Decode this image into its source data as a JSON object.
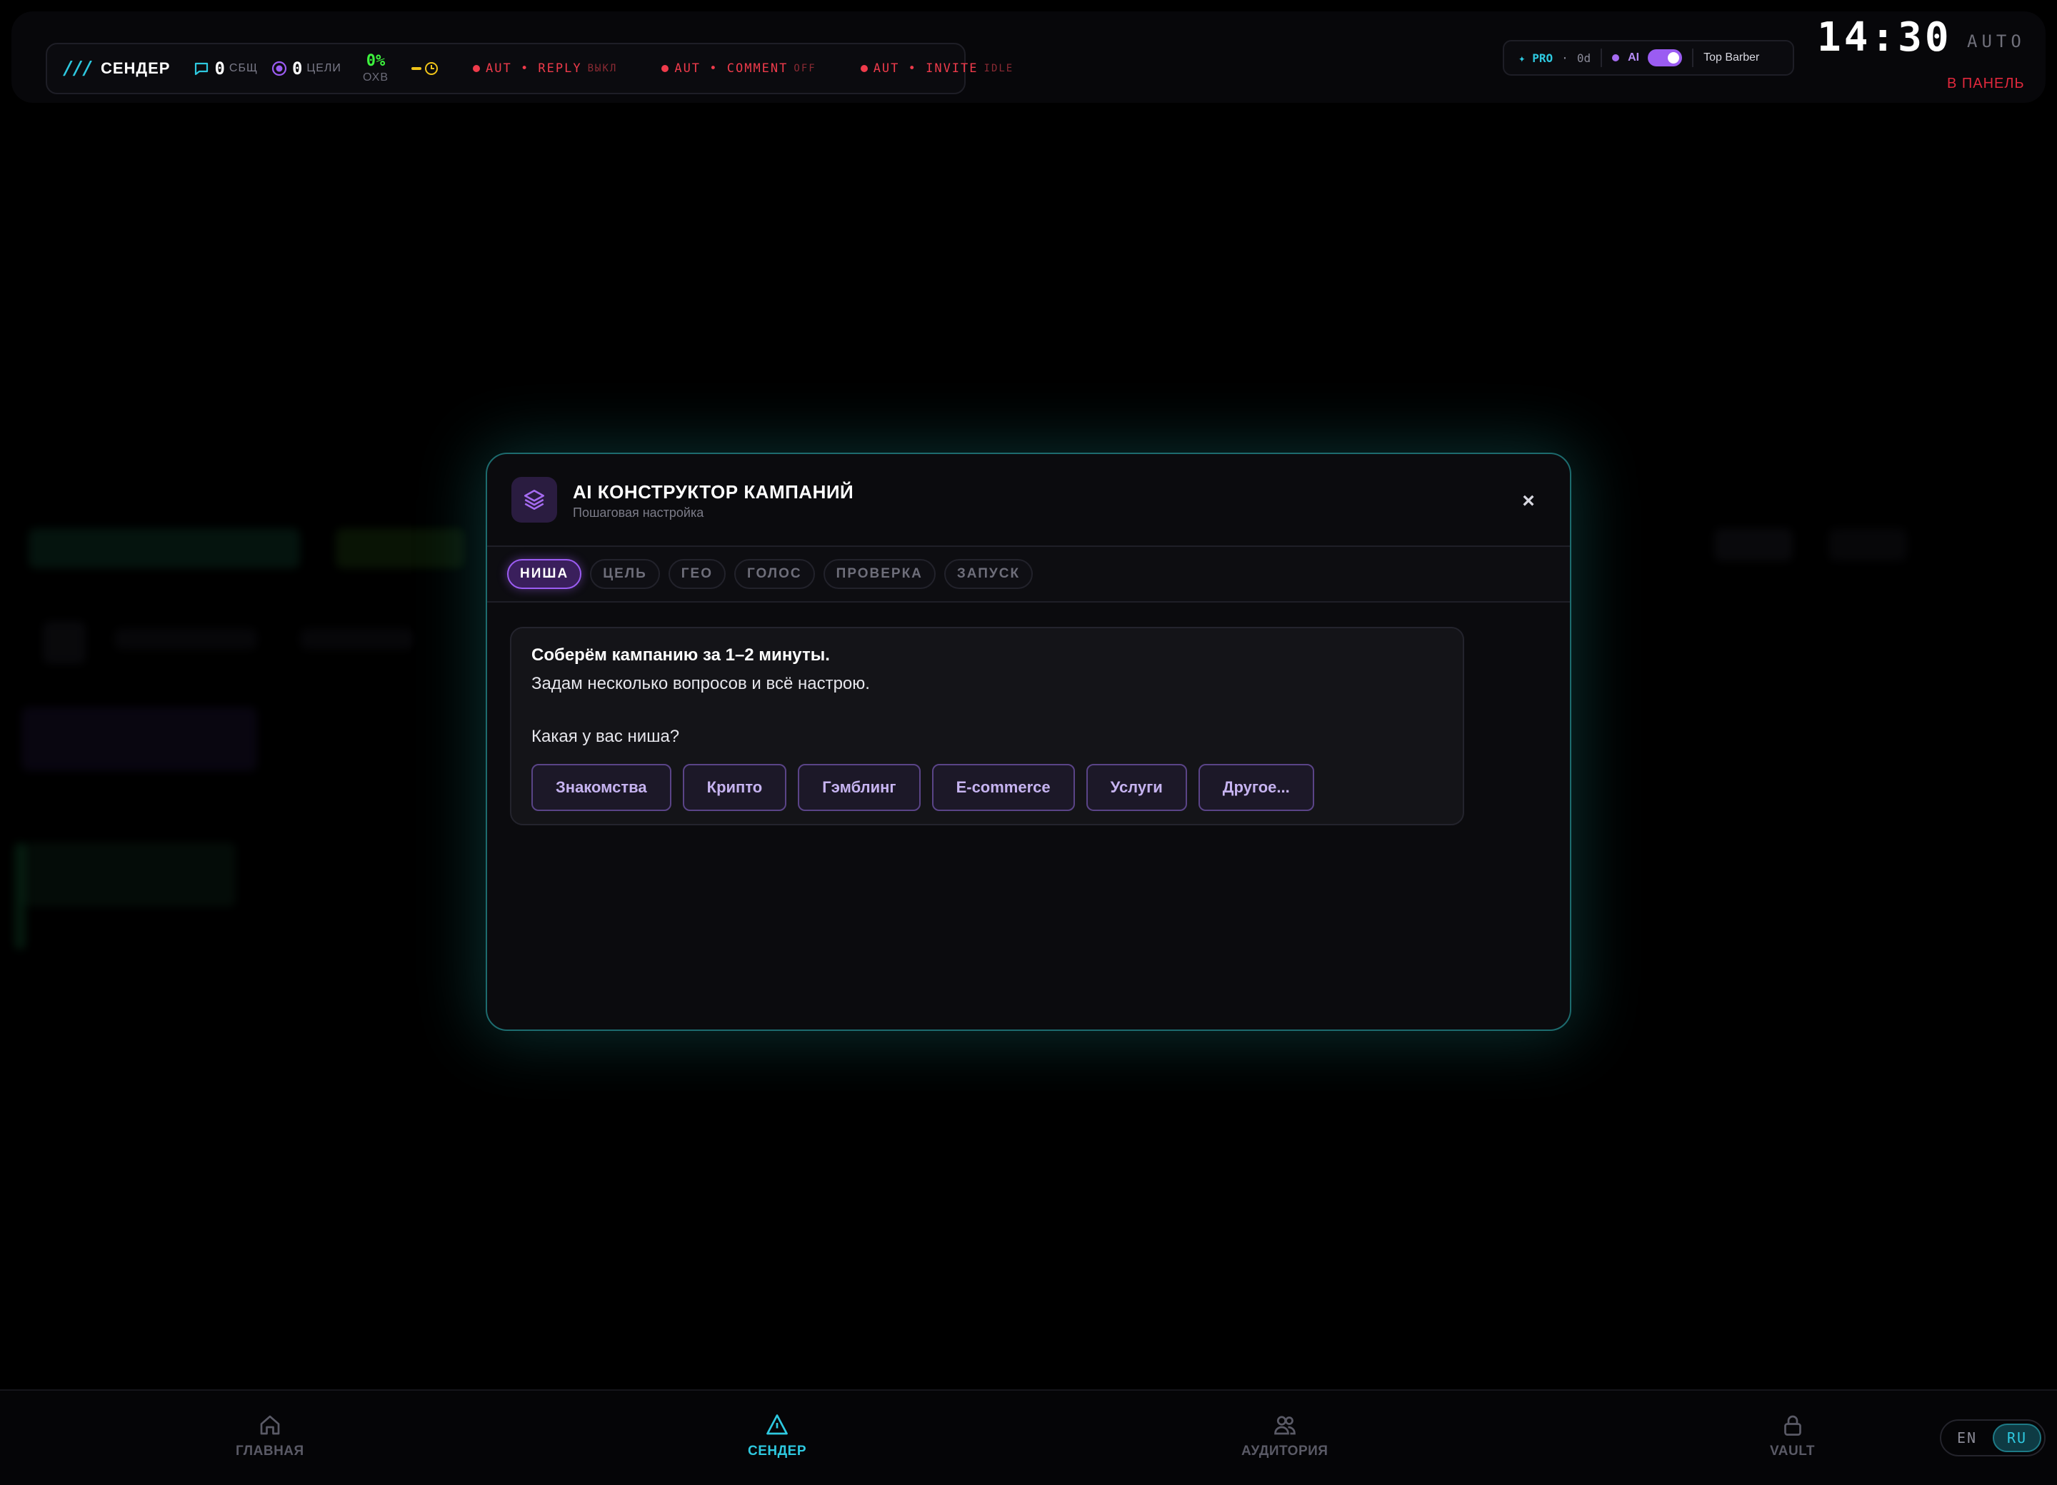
{
  "topbar": {
    "logo_mark": "///",
    "brand": "СЕНДЕР",
    "messages_count": "0",
    "messages_label": "СБЩ",
    "targets_count": "0",
    "targets_label": "ЦЕЛИ",
    "reach_value": "0%",
    "reach_label": "ОХВ",
    "automations": [
      {
        "key": "AUT • REPLY",
        "state": "ВЫКЛ"
      },
      {
        "key": "AUT • COMMENT",
        "state": "OFF"
      },
      {
        "key": "AUT • INVITE",
        "state": "IDLE"
      }
    ],
    "plan": "✦ PRO",
    "plan_sep": "·",
    "plan_days": "0d",
    "ai_label": "AI",
    "ai_enabled": true,
    "account": "Top Barber",
    "clock": "14:30",
    "mode": "AUTO",
    "panel_link": "В ПАНЕЛЬ"
  },
  "modal": {
    "title": "AI КОНСТРУКТОР КАМПАНИЙ",
    "subtitle": "Пошаговая настройка",
    "close": "×",
    "icon": "layers-icon",
    "tabs": [
      {
        "label": "НИША",
        "active": true
      },
      {
        "label": "ЦЕЛЬ",
        "active": false
      },
      {
        "label": "ГЕО",
        "active": false
      },
      {
        "label": "ГОЛОС",
        "active": false
      },
      {
        "label": "ПРОВЕРКА",
        "active": false
      },
      {
        "label": "ЗАПУСК",
        "active": false
      }
    ],
    "message_line1": "Соберём кампанию за 1–2 минуты.",
    "message_line2": "Задам несколько вопросов и всё настрою.",
    "question": "Какая у вас ниша?",
    "options": [
      "Знакомства",
      "Крипто",
      "Гэмблинг",
      "E-commerce",
      "Услуги",
      "Другое..."
    ]
  },
  "bottom_nav": {
    "items": [
      {
        "label": "ГЛАВНАЯ",
        "icon": "home-icon",
        "active": false
      },
      {
        "label": "СЕНДЕР",
        "icon": "send-icon",
        "active": true
      },
      {
        "label": "АУДИТОРИЯ",
        "icon": "users-icon",
        "active": false
      },
      {
        "label": "VAULT",
        "icon": "lock-icon",
        "active": false
      }
    ],
    "languages": [
      {
        "label": "EN",
        "active": false
      },
      {
        "label": "RU",
        "active": true
      }
    ]
  },
  "colors": {
    "accent_cyan": "#2ec9e0",
    "accent_purple": "#9b5cf2",
    "alert_red": "#ef3b4b",
    "reach_green": "#3df23d"
  }
}
